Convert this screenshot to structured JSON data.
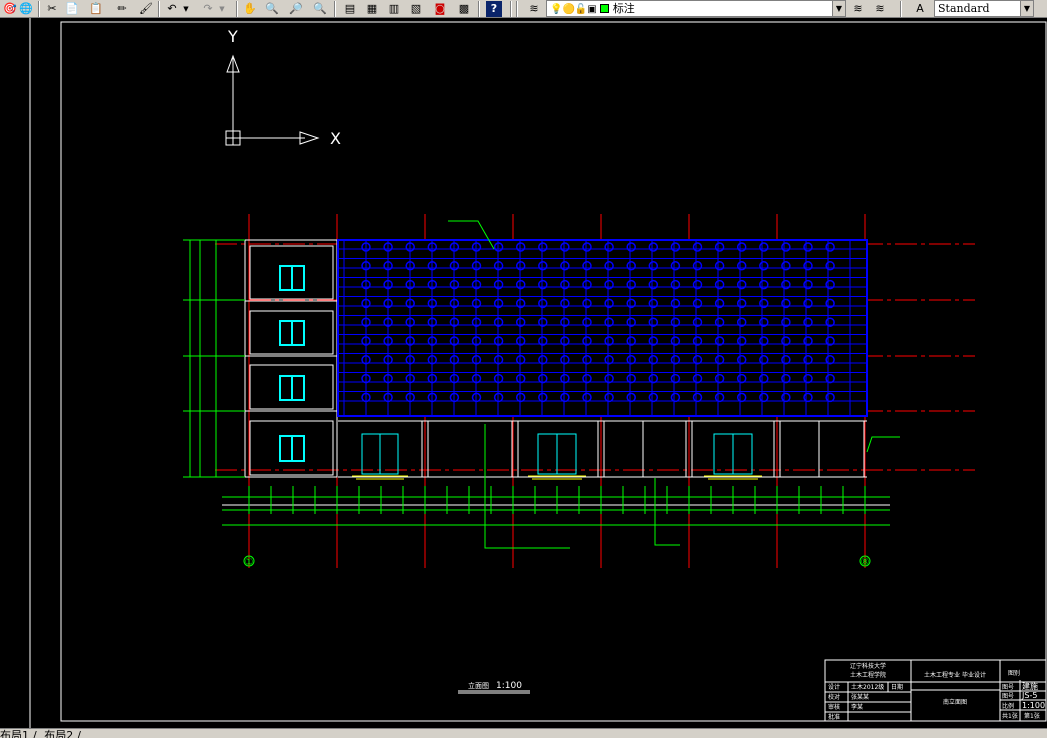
{
  "toolbar": {
    "layer_name": "标注",
    "text_style": "Standard",
    "icons": [
      "match-properties-icon",
      "publish-icon",
      "cut-icon",
      "copy-icon",
      "paste-icon",
      "pencil-icon",
      "brush-icon",
      "undo-icon",
      "redo-icon",
      "pan-icon",
      "zoom-realtime-icon",
      "zoom-window-icon",
      "zoom-previous-icon",
      "properties-icon",
      "design-center-icon",
      "tool-palettes-icon",
      "sheet-set-icon",
      "markup-icon",
      "calculator-icon",
      "help-icon",
      "layer-manager-icon",
      "layer-state-icons",
      "layer-previous-icon",
      "layer-walk-icon",
      "text-style-icon"
    ],
    "layer_color": "#00ff00"
  },
  "layout_tabs": [
    "布局1",
    "布局2"
  ],
  "drawing": {
    "ucs": {
      "y_label": "Y",
      "x_label": "X"
    },
    "grid_start_label": "①",
    "grid_end_label": "⑧",
    "title_caption": "立面图",
    "scale": "1:100",
    "colors": {
      "frame": "#ffffff",
      "grid_line": "#ff0000",
      "glass": "#0000ff",
      "dims": "#00ff00",
      "windows": "#00ffff"
    },
    "title_block": {
      "school_line1": "辽宁科技大学",
      "school_line2": "土木工程学院",
      "project": "土木工程专业 毕业设计",
      "drawing_name": "南立面图",
      "role_rows": [
        "设计",
        "校对",
        "审核",
        "批准"
      ],
      "student": "张某某",
      "advisor": "李某",
      "class": "土木2012级",
      "date": "日期",
      "drawing_no_label": "图号",
      "drawing_no": "JS-5",
      "scale_label": "比例",
      "scale": "1:100",
      "sheets": "共1张",
      "sheet_no": "第1张",
      "label_right": "图别",
      "category": "建施"
    }
  }
}
